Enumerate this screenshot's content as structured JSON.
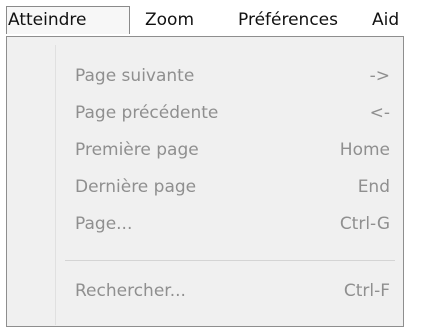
{
  "menubar": {
    "items": [
      {
        "label": "Atteindre"
      },
      {
        "label": "Zoom"
      },
      {
        "label": "Préférences"
      },
      {
        "label": "Aid"
      }
    ]
  },
  "menu": {
    "items": [
      {
        "label": "Page suivante",
        "shortcut": "->"
      },
      {
        "label": "Page précédente",
        "shortcut": "<-"
      },
      {
        "label": "Première page",
        "shortcut": "Home"
      },
      {
        "label": "Dernière page",
        "shortcut": "End"
      },
      {
        "label": "Page...",
        "shortcut": "Ctrl-G"
      },
      {
        "label": "Rechercher...",
        "shortcut": "Ctrl-F"
      }
    ]
  }
}
